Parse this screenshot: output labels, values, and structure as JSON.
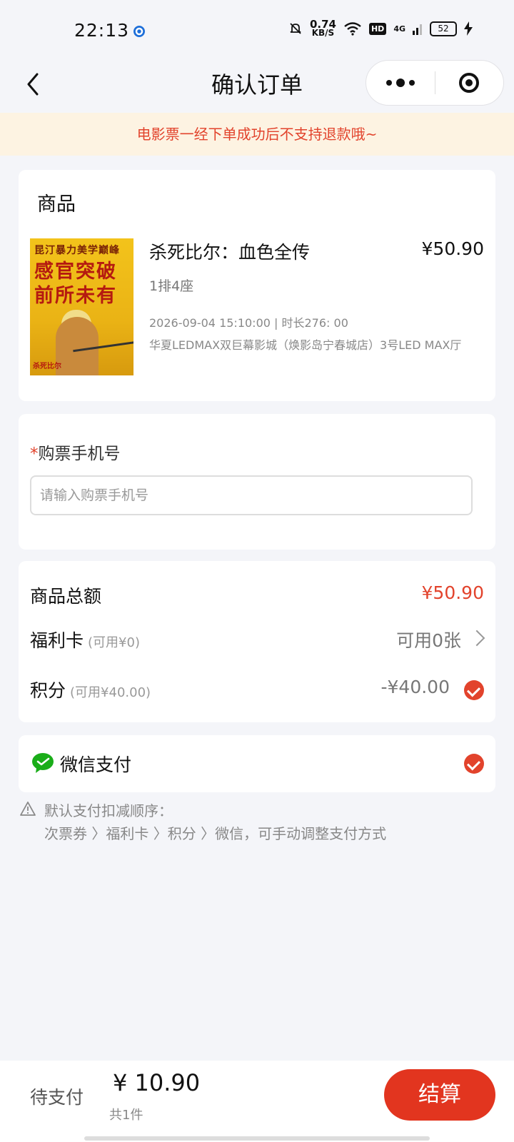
{
  "status_bar": {
    "time": "22:13",
    "speed_value": "0.74",
    "speed_unit": "KB/S",
    "hd": "HD",
    "network": "4G",
    "battery": "52"
  },
  "nav": {
    "title": "确认订单"
  },
  "notice": "电影票一经下单成功后不支持退款哦~",
  "product": {
    "section_title": "商品",
    "poster_line1": "昆汀暴力美学巅峰",
    "poster_line2": "感官突破",
    "poster_line3": "前所未有",
    "poster_caption": "杀死比尔",
    "movie_title": "杀死比尔：血色全传",
    "price": "¥50.90",
    "seat": "1排4座",
    "showtime": "2026-09-04 15:10:00 | 时长276: 00",
    "cinema": "华夏LEDMAX双巨幕影城（焕影岛宁春城店）3号LED MAX厅"
  },
  "phone": {
    "required_mark": "*",
    "label": "购票手机号",
    "value": "",
    "placeholder": "请输入购票手机号"
  },
  "summary": {
    "total_label": "商品总额",
    "total_value": "¥50.90",
    "welfare_label": "福利卡",
    "welfare_note": "(可用¥0)",
    "welfare_value": "可用0张",
    "points_label": "积分",
    "points_note": "(可用¥40.00)",
    "points_value": "-¥40.00"
  },
  "payment": {
    "label": "微信支付"
  },
  "tip": {
    "line1": "默认支付扣减顺序：",
    "line2": "次票券 〉福利卡 〉积分 〉微信，可手动调整支付方式"
  },
  "footer": {
    "pending_label": "待支付",
    "amount": "¥ 10.90",
    "count": "共1件",
    "checkout": "结算"
  },
  "colors": {
    "accent": "#e2432c",
    "notice_bg": "#fdf3e2",
    "wechat_green": "#1aad19"
  }
}
